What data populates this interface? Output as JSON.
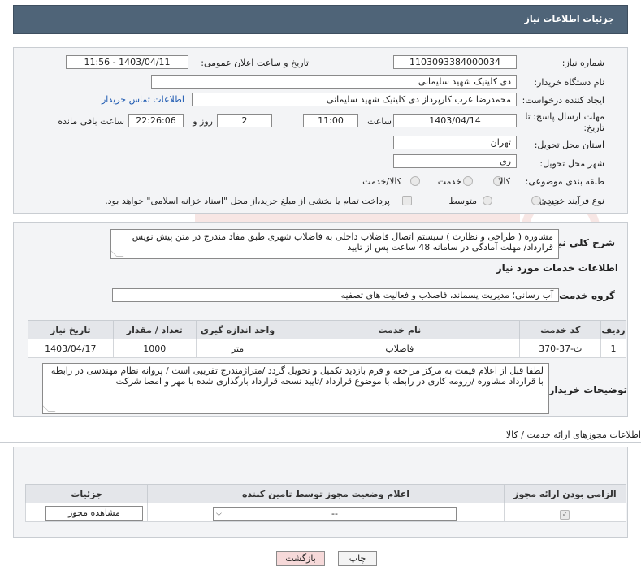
{
  "header": {
    "title": "جزئیات اطلاعات نیاز"
  },
  "form": {
    "need_number_label": "شماره نیاز:",
    "need_number": "1103093384000034",
    "announce_label": "تاریخ و ساعت اعلان عمومی:",
    "announce_value": "1403/04/11 - 11:56",
    "buyer_org_label": "نام دستگاه خریدار:",
    "buyer_org": "دی کلینیک شهید سلیمانی",
    "requester_label": "ایجاد کننده درخواست:",
    "requester": "محمدرضا عرب کارپرداز دی کلینیک شهید سلیمانی",
    "contact_link": "اطلاعات تماس خریدار",
    "deadline_label": "مهلت ارسال پاسخ: تا تاریخ:",
    "deadline_date": "1403/04/14",
    "time_label": "ساعت",
    "deadline_time": "11:00",
    "days_value": "2",
    "days_label": "روز و",
    "remaining_time": "22:26:06",
    "remaining_label": "ساعت باقی مانده",
    "province_label": "استان محل تحویل:",
    "province": "تهران",
    "city_label": "شهر محل تحویل:",
    "city": "ری",
    "category_label": "طبقه بندی موضوعی:",
    "category_options": [
      "کالا",
      "خدمت",
      "کالا/خدمت"
    ],
    "process_label": "نوع فرآیند خرید :",
    "process_options": [
      "جزیی",
      "متوسط"
    ],
    "payment_note": "پرداخت تمام یا بخشی از مبلغ خرید،از محل \"اسناد خزانه اسلامی\" خواهد بود."
  },
  "description": {
    "label": "شرح کلی نیاز:",
    "text": "مشاوره ( طراحی و نظارت ) سیستم اتصال فاضلاب داخلی به فاضلاب شهری طبق مفاد مندرج در متن پیش نویس قرارداد/ مهلت آمادگی در سامانه 48 ساعت پس از تایید"
  },
  "services": {
    "section_title": "اطلاعات خدمات مورد نیاز",
    "group_label": "گروه خدمت:",
    "group_value": "آب رسانی؛ مدیریت پسماند، فاضلاب و فعالیت های تصفیه",
    "columns": [
      "ردیف",
      "کد خدمت",
      "نام خدمت",
      "واحد اندازه گیری",
      "تعداد / مقدار",
      "تاریخ نیاز"
    ],
    "rows": [
      {
        "row": "1",
        "code": "ث-37-370",
        "name": "فاضلاب",
        "unit": "متر",
        "qty": "1000",
        "date": "1403/04/17"
      }
    ]
  },
  "buyer_notes": {
    "label": "توضیحات خریدار:",
    "text": "لطفا قبل از اعلام قیمت به مرکز مراجعه و فرم بازدید تکمیل و تحویل گردد /متراژمندرج تقریبی است / پروانه نظام مهندسی در رابطه با قرارداد مشاوره /رزومه کاری در رابطه با موضوع قرارداد /تایید نسخه قرارداد بارگذاری شده با مهر و امضا شرکت"
  },
  "permits": {
    "title": "اطلاعات مجوزهای ارائه خدمت / کالا",
    "columns": [
      "الزامی بودن ارائه مجوز",
      "اعلام وضعیت مجوز توسط تامین کننده",
      "جزئیات"
    ],
    "select_value": "--",
    "view_button": "مشاهده مجوز"
  },
  "footer": {
    "print_button": "چاپ",
    "back_button": "بازگشت"
  },
  "colors": {
    "header_bg": "#4f6478",
    "link": "#1a57b0",
    "back_btn_bg": "#f6d9d9"
  }
}
